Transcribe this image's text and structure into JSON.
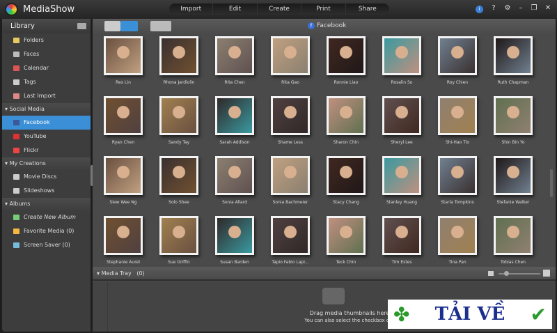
{
  "app": {
    "title": "MediaShow"
  },
  "menu": [
    "Import",
    "Edit",
    "Create",
    "Print",
    "Share"
  ],
  "window_controls": {
    "info": "i",
    "help": "?",
    "settings": "⚙",
    "minimize": "–",
    "restore": "❐",
    "close": "✕"
  },
  "sidebar": {
    "title": "Library",
    "library": [
      {
        "label": "Folders",
        "color": "#e8c860"
      },
      {
        "label": "Faces",
        "color": "#bbb"
      },
      {
        "label": "Calendar",
        "color": "#d55"
      },
      {
        "label": "Tags",
        "color": "#ccc"
      },
      {
        "label": "Last Import",
        "color": "#d88"
      }
    ],
    "social_header": "Social Media",
    "social": [
      {
        "label": "Facebook",
        "color": "#3b5998",
        "selected": true
      },
      {
        "label": "YouTube",
        "color": "#d33"
      },
      {
        "label": "Flickr",
        "color": "#e44"
      }
    ],
    "creations_header": "My Creations",
    "creations": [
      {
        "label": "Movie Discs",
        "color": "#ccc"
      },
      {
        "label": "Slideshows",
        "color": "#ccc"
      }
    ],
    "albums_header": "Albums",
    "albums": [
      {
        "label": "Create New Album",
        "color": "#7c7"
      },
      {
        "label": "Favorite Media (0)",
        "color": "#f5b840"
      },
      {
        "label": "Screen Saver (0)",
        "color": "#7bd"
      }
    ]
  },
  "toolbar": {
    "source": "Facebook"
  },
  "people": [
    "Rex Lin",
    "Rhona Jardiolin",
    "Rita Chen",
    "Rita Gao",
    "Ronnie Liao",
    "Rosalin So",
    "Roy Chien",
    "Ruth Chapman",
    "Ryan Chen",
    "Sandy Tay",
    "Sarah Addison",
    "Shame Less",
    "Sharon Chin",
    "Sheryl Lee",
    "Shi-Hao Tio",
    "Shin Bin Yo",
    "Siew Wee Ng",
    "Solo Shee",
    "Sonia Allard",
    "Sonia Bachmeier",
    "Stacy Chang",
    "Stanley Huang",
    "Starla Tompkins",
    "Stefanie Walker",
    "Stephanie Aurel",
    "Sue Griffin",
    "Susan Barden",
    "Tapio Fabio Lapi...",
    "Teck Chin",
    "Tim Estes",
    "Tina Pan",
    "Tobias Chen"
  ],
  "tray": {
    "label": "Media Tray",
    "count": "(0)",
    "hint1": "Drag media thumbnails here to add the media to",
    "hint2": "You can also select the checkbox on the thumbnail to add m"
  },
  "watermark": {
    "text": "TẢI VỀ"
  }
}
